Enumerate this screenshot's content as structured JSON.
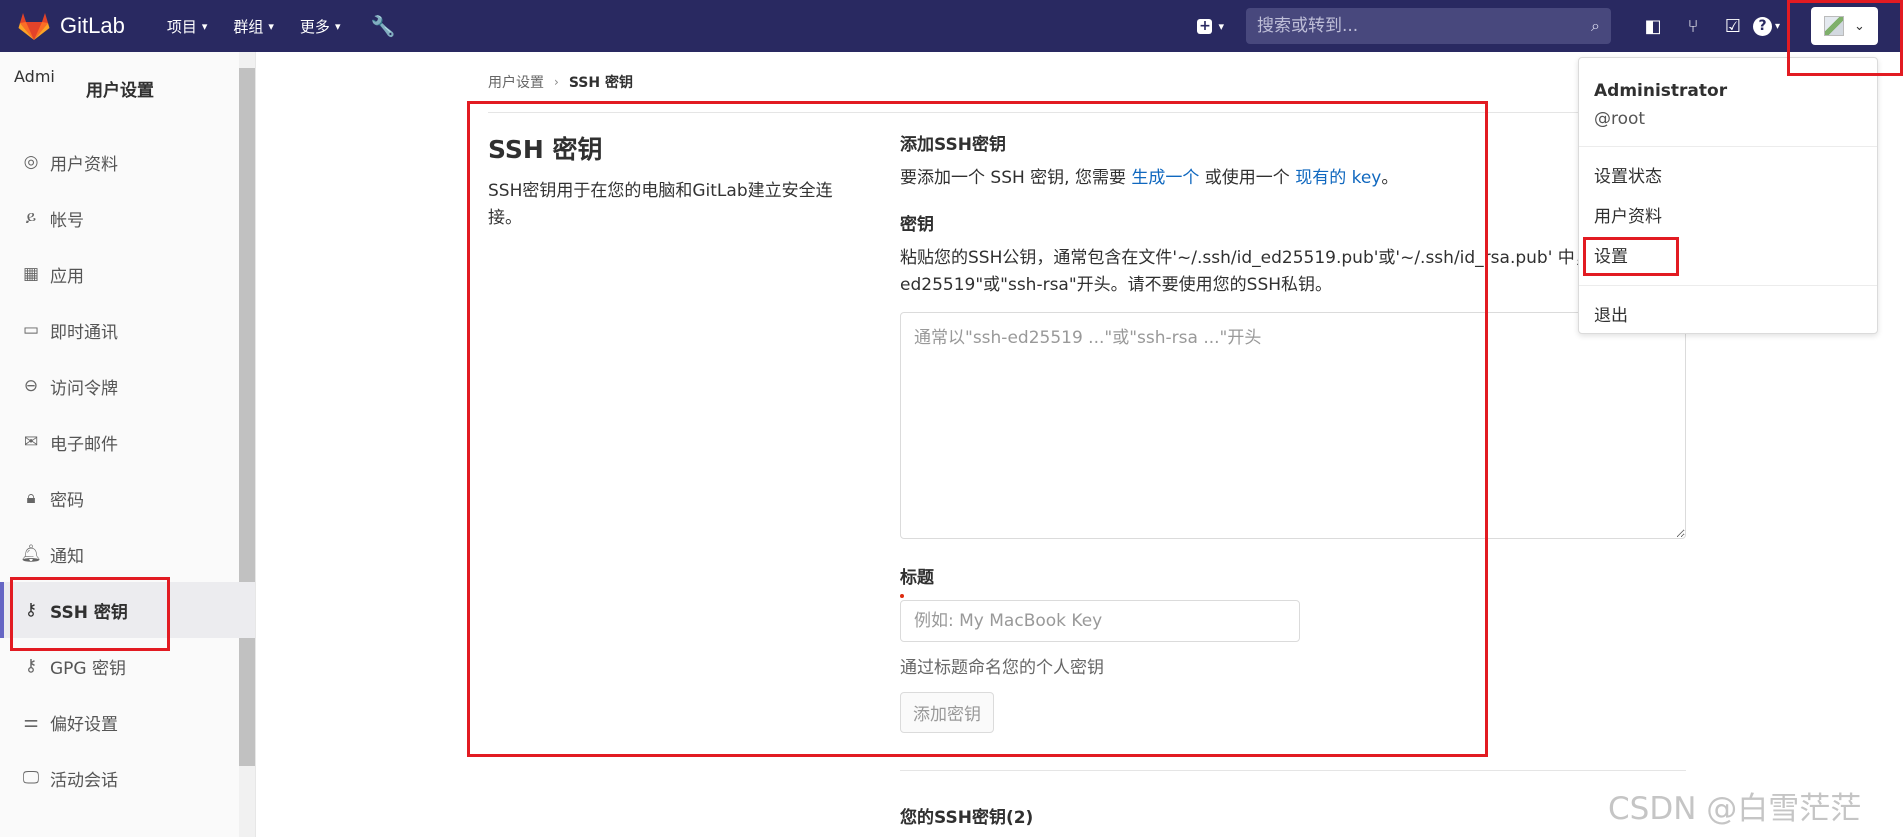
{
  "navbar": {
    "brand": "GitLab",
    "menu": [
      {
        "label": "项目"
      },
      {
        "label": "群组"
      },
      {
        "label": "更多"
      }
    ],
    "search_placeholder": "搜索或转到..."
  },
  "sidebar": {
    "avatar_alt": "Admi",
    "title": "用户设置",
    "items": [
      {
        "label": "用户资料",
        "icon": "user-circle-icon"
      },
      {
        "label": "帐号",
        "icon": "account-gear-icon"
      },
      {
        "label": "应用",
        "icon": "grid-icon"
      },
      {
        "label": "即时通讯",
        "icon": "comment-icon"
      },
      {
        "label": "访问令牌",
        "icon": "token-icon"
      },
      {
        "label": "电子邮件",
        "icon": "mail-icon"
      },
      {
        "label": "密码",
        "icon": "lock-icon"
      },
      {
        "label": "通知",
        "icon": "bell-icon"
      },
      {
        "label": "SSH 密钥",
        "icon": "key-icon",
        "active": true
      },
      {
        "label": "GPG 密钥",
        "icon": "key-icon"
      },
      {
        "label": "偏好设置",
        "icon": "preferences-icon"
      },
      {
        "label": "活动会话",
        "icon": "monitor-icon"
      }
    ]
  },
  "breadcrumb": {
    "parent": "用户设置",
    "current": "SSH 密钥"
  },
  "section": {
    "title": "SSH 密钥",
    "description": "SSH密钥用于在您的电脑和GitLab建立安全连接。"
  },
  "form": {
    "add_heading": "添加SSH密钥",
    "intro_before": "要添加一个 SSH 密钥, 您需要 ",
    "intro_link1": "生成一个",
    "intro_middle": " 或使用一个 ",
    "intro_link2": "现有的 key",
    "intro_after": "。",
    "key_label": "密钥",
    "key_help": "粘贴您的SSH公钥，通常包含在文件'~/.ssh/id_ed25519.pub'或'~/.ssh/id_rsa.pub' 中，并以\"ssh-ed25519\"或\"ssh-rsa\"开头。请不要使用您的SSH私钥。",
    "key_placeholder": "通常以\"ssh-ed25519 ...\"或\"ssh-rsa ...\"开头",
    "title_label": "标题",
    "title_placeholder": "例如: My MacBook Key",
    "title_help": "通过标题命名您的个人密钥",
    "submit_label": "添加密钥"
  },
  "keys_list": {
    "heading": "您的SSH密钥(2)"
  },
  "user_dropdown": {
    "name": "Administrator",
    "handle": "@root",
    "items": [
      "设置状态",
      "用户资料",
      "设置"
    ],
    "signout": "退出"
  },
  "watermark": "CSDN @白雪茫茫",
  "colors": {
    "navbar": "#292961",
    "link": "#1068bf",
    "annotation": "#e21b22"
  }
}
